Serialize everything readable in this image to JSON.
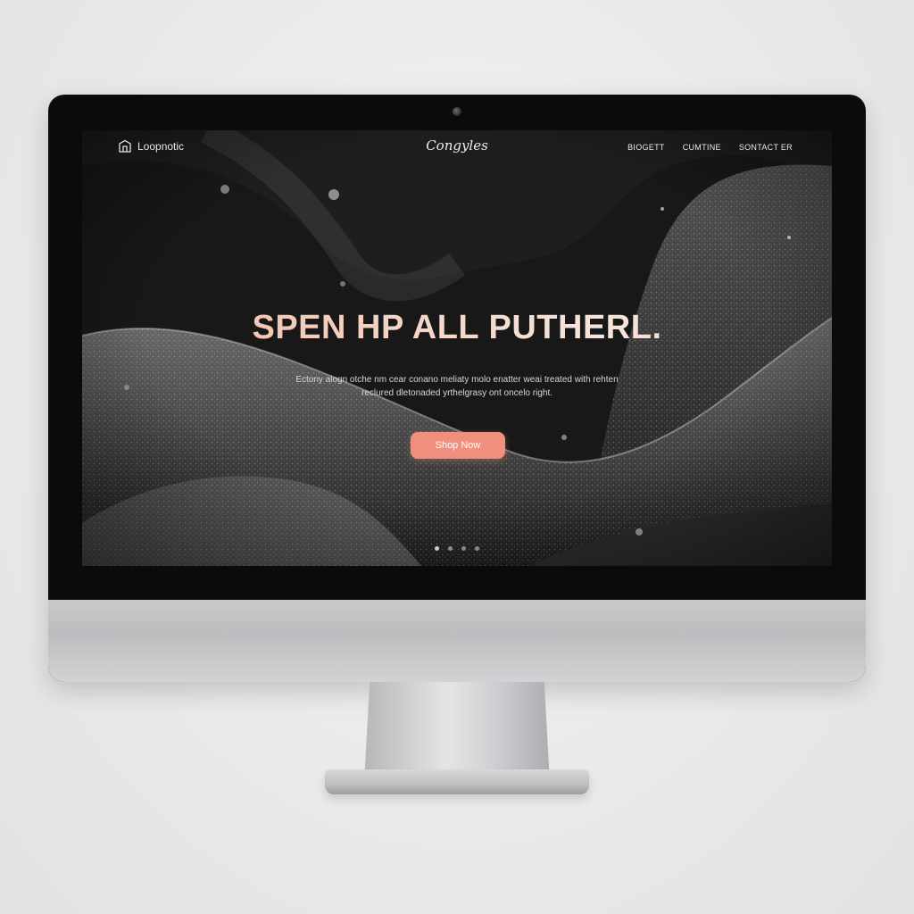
{
  "site": {
    "logo_text": "Loopnotic",
    "brand": "Congyles"
  },
  "nav": {
    "items": [
      {
        "label": "BIOGETT"
      },
      {
        "label": "CUMTINE"
      },
      {
        "label": "SONTACT ER"
      }
    ]
  },
  "hero": {
    "title": "SPEN HP ALL PUTHERL.",
    "subtitle_line1": "Ectony alogn otche nm cear conano meliaty molo enatter weai treated with rehten",
    "subtitle_line2": "reclured dletonaded yrthelgrasy ont oncelo right.",
    "cta_label": "Shop Now"
  },
  "carousel": {
    "slide_count": 4,
    "active_index": 0
  },
  "colors": {
    "accent": "#f18f7e",
    "title_gradient_start": "#f2b69c",
    "title_gradient_end": "#f6e6dd",
    "screen_background": "#151515"
  },
  "icons": {
    "logo": "home-outline-icon"
  }
}
